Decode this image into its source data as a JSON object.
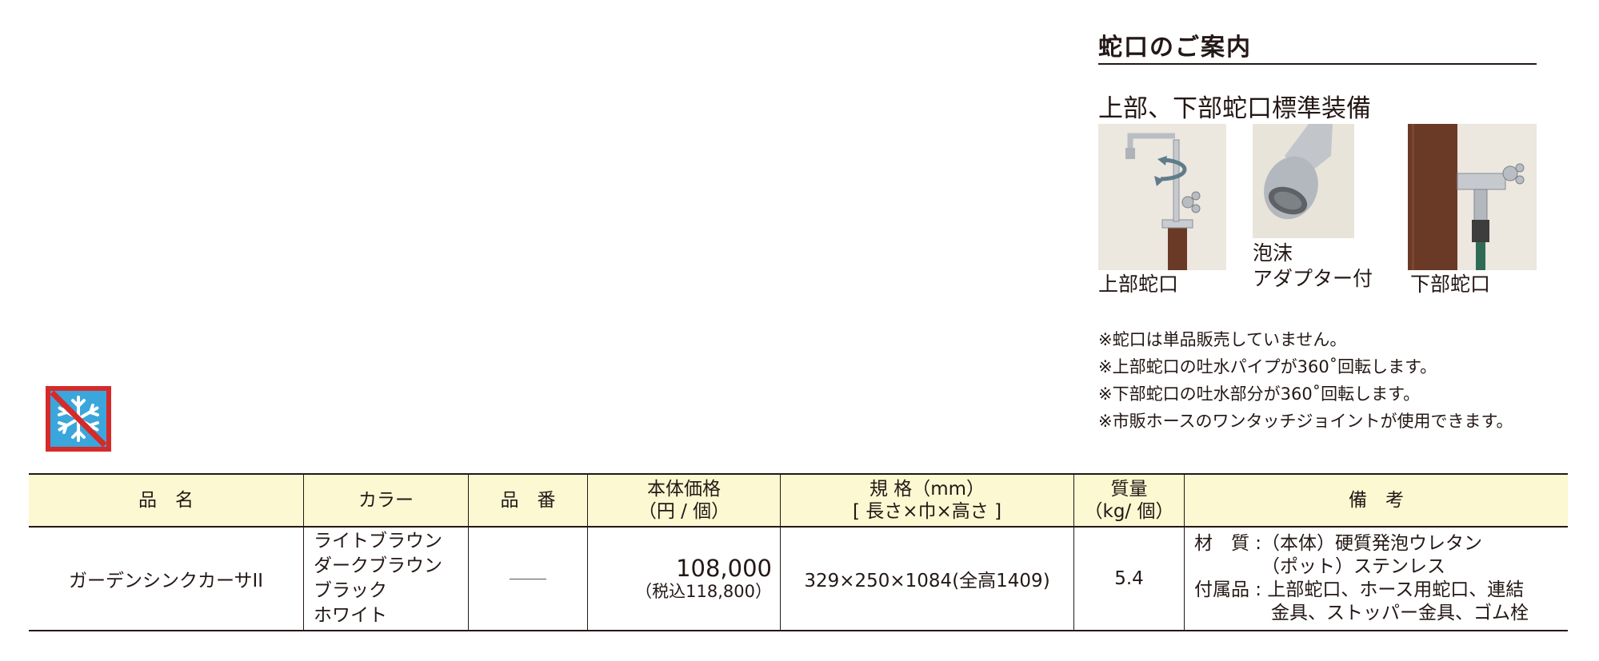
{
  "faucet_guide": {
    "title": "蛇口のご案内",
    "subtitle": "上部、下部蛇口標準装備",
    "photos": [
      {
        "caption": "上部蛇口"
      },
      {
        "caption_line1": "泡沫",
        "caption_line2": "アダプター付"
      },
      {
        "caption": "下部蛇口"
      }
    ],
    "notes": [
      "※蛇口は単品販売していません。",
      "※上部蛇口の吐水パイプが360˚回転します。",
      "※下部蛇口の吐水部分が360˚回転します。",
      "※市販ホースのワンタッチジョイントが使用できます。"
    ]
  },
  "icons": {
    "no_freeze": "snowflake-prohibited-icon"
  },
  "colors": {
    "header_bg": "#fbf8d2",
    "icon_red": "#d52a2a",
    "icon_blue": "#3ba6dc",
    "text": "#231815"
  },
  "table": {
    "headers": {
      "name": "品　名",
      "color": "カラー",
      "code": "品　番",
      "price_line1": "本体価格",
      "price_line2": "（円 / 個）",
      "spec_line1": "規 格（mm）",
      "spec_line2": "[ 長さ×巾×高さ ]",
      "weight_line1": "質量",
      "weight_line2": "（kg/ 個）",
      "remarks": "備　考"
    },
    "row": {
      "name": "ガーデンシンクカーサII",
      "colors": [
        "ライトブラウン",
        "ダークブラウン",
        "ブラック",
        "ホワイト"
      ],
      "price": "108,000",
      "price_tax": "（税込118,800）",
      "spec": "329×250×1084(全高1409)",
      "weight": "5.4",
      "remarks_line1": "材　質 :（本体）硬質発泡ウレタン",
      "remarks_line2": "（ポット）ステンレス",
      "remarks_line3": "付属品 : 上部蛇口、ホース用蛇口、連結",
      "remarks_line4": "金具、ストッパー金具、ゴム栓"
    }
  }
}
